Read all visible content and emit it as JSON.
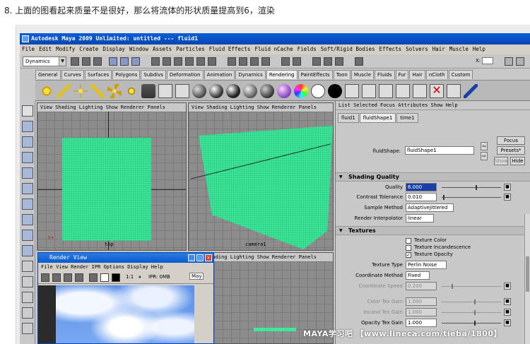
{
  "caption": "8. 上面的图看起来质量不是很好，那么将流体的形状质量提高到6，渲染",
  "window": {
    "title": "Autodesk Maya 2009 Unlimited: untitled   ---   fluid1"
  },
  "menu": [
    "File",
    "Edit",
    "Modify",
    "Create",
    "Display",
    "Window",
    "Assets",
    "Particles",
    "Fluid Effects",
    "Fluid nCache",
    "Fields",
    "Soft/Rigid Bodies",
    "Effects",
    "Solvers",
    "Hair",
    "Muscle",
    "Help"
  ],
  "status_line": {
    "mode": "Dynamics",
    "x_label": "X:"
  },
  "shelf_tabs": [
    "General",
    "Curves",
    "Surfaces",
    "Polygons",
    "Subdivs",
    "Deformation",
    "Animation",
    "Dynamics",
    "Rendering",
    "PaintEffects",
    "Toon",
    "Muscle",
    "Fluids",
    "Fur",
    "Hair",
    "nCloth",
    "Custom"
  ],
  "shelf_tabs_active": "Rendering",
  "viewport_menu": "View Shading Lighting Show Renderer Panels",
  "viewports": {
    "top_label": "top",
    "persp_label": "camera1"
  },
  "render_view": {
    "title": "Render View",
    "menu": "File View Render IPR Options Display Help",
    "ipr_label": "IPR: 0MB",
    "ratio": "1:1",
    "extra": "May"
  },
  "attr_editor": {
    "menu": "List Selected Focus Attributes Show Help",
    "tabs": [
      "fluid1",
      "fluidShape1",
      "time1"
    ],
    "active_tab": "fluidShape1",
    "node_label": "fluidShape:",
    "node_value": "fluidShape1",
    "buttons": {
      "focus": "Focus",
      "presets": "Presets*",
      "show": "Show",
      "hide": "Hide"
    },
    "shading_quality": {
      "title": "Shading Quality",
      "quality_label": "Quality",
      "quality_value": "6.000",
      "contrast_label": "Contrast Tolerance",
      "contrast_value": "0.010",
      "sample_label": "Sample Method",
      "sample_value": "AdaptiveJittered",
      "interp_label": "Render Interpolator",
      "interp_value": "linear"
    },
    "textures": {
      "title": "Textures",
      "texture_color": "Texture Color",
      "texture_incandescence": "Texture Incandescence",
      "texture_opacity": "Texture Opacity",
      "type_label": "Texture Type",
      "type_value": "Perlin Noise",
      "coord_label": "Coordinate Method",
      "coord_value": "Fixed",
      "speed_label": "Coordinate Speed",
      "speed_value": "0.200",
      "color_gain_label": "Color Tex Gain",
      "color_gain_value": "1.000",
      "incand_gain_label": "Incand Tex Gain",
      "incand_gain_value": "1.000",
      "opacity_gain_label": "Opacity Tex Gain",
      "opacity_gain_value": "1.000"
    }
  },
  "watermark": "MAYA学习吧 【www.lineca.com/tieba/1800】"
}
